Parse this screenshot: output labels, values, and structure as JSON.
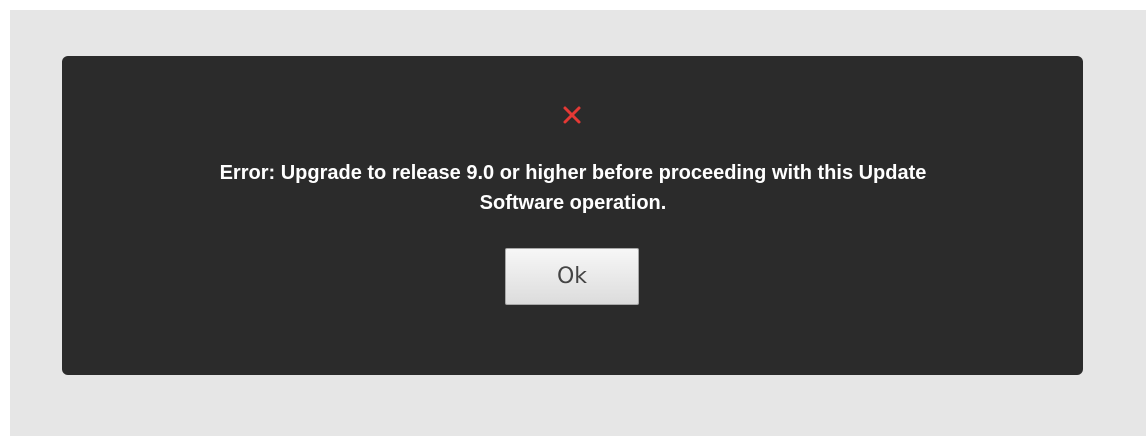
{
  "dialog": {
    "icon": "error-x-icon",
    "icon_color": "#e53935",
    "message_line_1": "Error: Upgrade to release 9.0 or higher before proceeding with this Update",
    "message_line_2": "Software operation.",
    "ok_label": "Ok"
  }
}
